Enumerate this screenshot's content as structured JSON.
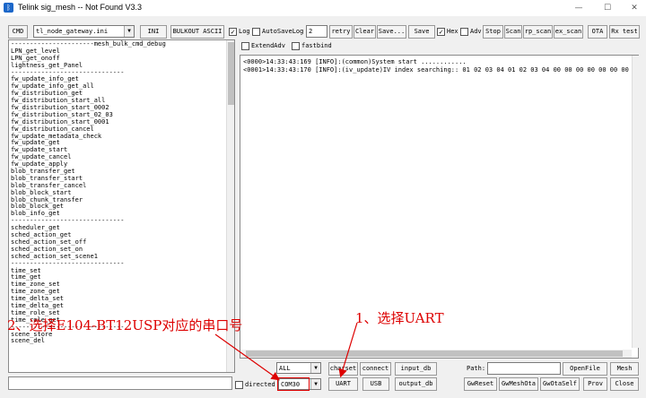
{
  "window": {
    "title": "Telink sig_mesh -- Not Found  V3.3",
    "minimize": "—",
    "maximize": "☐",
    "close": "✕"
  },
  "toolbar": {
    "cmd": "CMD",
    "ini_file": "tl_node_gateway.ini",
    "ini": "INI",
    "bulkout": "BULKOUT ASCII",
    "log": "Log",
    "autosavelog": "AutoSaveLog",
    "retry_value": "2",
    "retry": "retry",
    "clear": "Clear",
    "save_as": "Save...",
    "save": "Save",
    "hex": "Hex",
    "adv": "Adv",
    "stop": "Stop",
    "scan": "Scan",
    "rp_scan": "rp_scan",
    "ex_scan": "ex_scan",
    "ota": "OTA",
    "rx_test": "Rx test",
    "extend_adv": "ExtendAdv",
    "fastbind": "fastbind"
  },
  "commands": [
    "----------------------mesh_bulk_cmd_debug",
    "LPN_get_level",
    "LPN_get_onoff",
    "lightness_get_Panel",
    "------------------------------",
    "fw_update_info_get",
    "fw_update_info_get_all",
    "fw_distribution_get",
    "fw_distribution_start_all",
    "fw_distribution_start_0002",
    "fw_distribution_start_02_03",
    "fw_distribution_start_0001",
    "fw_distribution_cancel",
    "fw_update_metadata_check",
    "fw_update_get",
    "fw_update_start",
    "fw_update_cancel",
    "fw_update_apply",
    "blob_transfer_get",
    "blob_transfer_start",
    "blob_transfer_cancel",
    "blob_block_start",
    "blob_chunk_transfer",
    "blob_block_get",
    "blob_info_get",
    "------------------------------",
    "scheduler_get",
    "sched_action_get",
    "sched_action_set_off",
    "sched_action_set_on",
    "sched_action_set_scene1",
    "------------------------------",
    "time_set",
    "time_get",
    "time_zone_set",
    "time_zone_get",
    "time_delta_set",
    "time_delta_get",
    "time_role_set",
    "time_role_get",
    "------------------------------",
    "scene_store",
    "scene_del"
  ],
  "log_lines": [
    "<0000>14:33:43:169 [INFO]:(common)System start ............",
    "<0001>14:33:43:170 [INFO]:(iv_update)IV index searching:: 01 02 03 04 01 02 03 04 00 00 00 00 00 00 00"
  ],
  "bottom": {
    "filter_value": "ALL",
    "charset": "charset",
    "connect": "connect",
    "input_db": "input_db",
    "path_label": "Path:",
    "openfile": "OpenFile",
    "mesh": "Mesh",
    "directed": "directed",
    "com_port": "COM30",
    "uart": "UART",
    "usb": "USB",
    "output_db": "output_db",
    "gwreset": "GwReset",
    "gwmeshota": "GwMeshOta",
    "gwotaself": "GwOtaSelf",
    "prov": "Prov",
    "close": "Close"
  },
  "annotations": {
    "step1": "1、选择UART",
    "step2": "2、选择E104-BT12USP对应的串口号",
    "color": "#dd0000"
  }
}
